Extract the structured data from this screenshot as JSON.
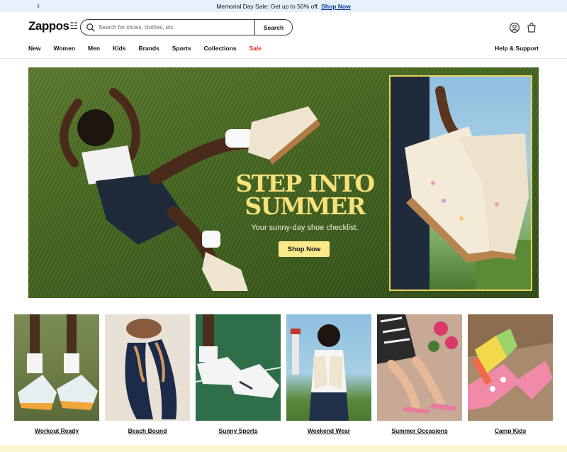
{
  "promo": {
    "text": "Memorial Day Sale: Get up to 50% off.",
    "link": "Shop Now"
  },
  "header": {
    "logo": "Zappos",
    "search_placeholder": "Search for shoes, clothes, etc.",
    "search_button": "Search"
  },
  "nav": {
    "items": [
      "New",
      "Women",
      "Men",
      "Kids",
      "Brands",
      "Sports",
      "Collections",
      "Sale"
    ],
    "help": "Help & Support"
  },
  "hero": {
    "headline_line1": "STEP INTO",
    "headline_line2": "SUMMER",
    "subhead": "Your sunny-day shoe checklist.",
    "cta": "Shop Now"
  },
  "categories": [
    {
      "label": "Workout Ready"
    },
    {
      "label": "Beach Bound"
    },
    {
      "label": "Sunny Sports"
    },
    {
      "label": "Weekend Wear"
    },
    {
      "label": "Summer Occasions"
    },
    {
      "label": "Camp Kids"
    }
  ],
  "colors": {
    "promo_bg": "#e6f1fb",
    "sale_red": "#d2281c",
    "hero_headline": "#f6e27b",
    "hero_cta_bg": "#fcea8a",
    "inset_border": "#e9d35e"
  }
}
